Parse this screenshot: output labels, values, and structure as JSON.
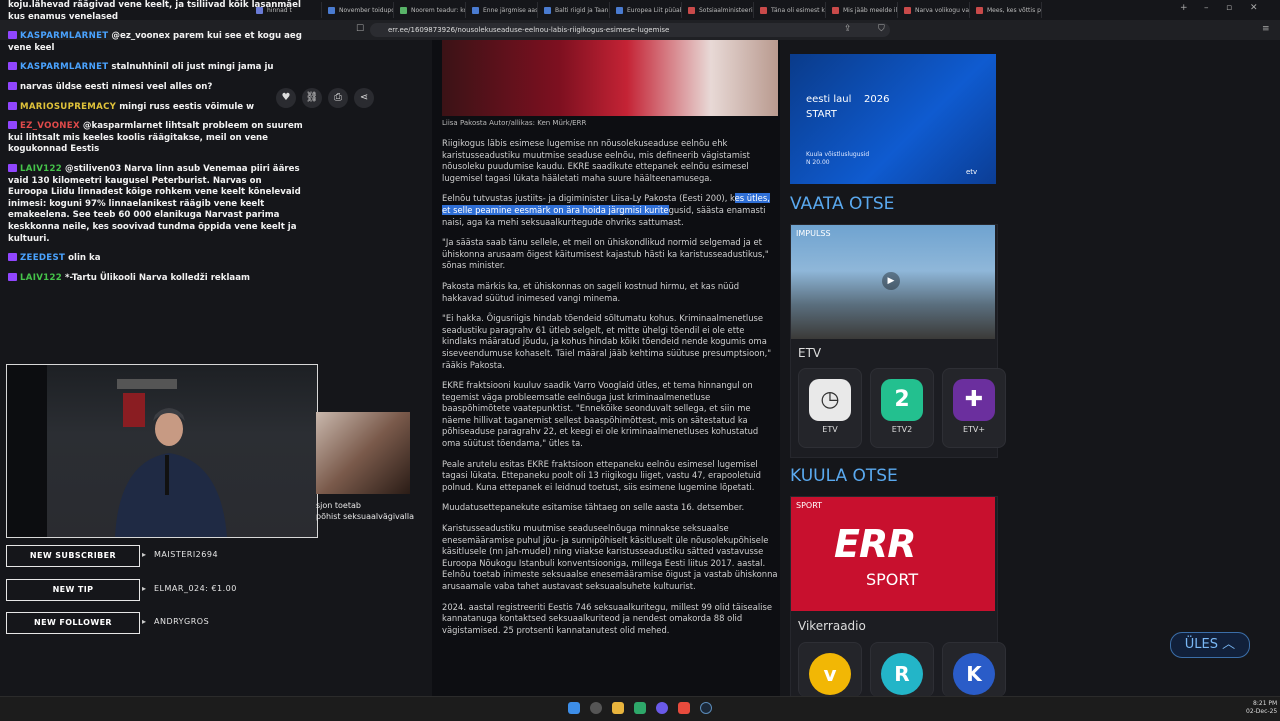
{
  "browser": {
    "tabs": [
      {
        "label": "hinnad t",
        "color": "#6a7bd6"
      },
      {
        "label": "November toidupoes",
        "color": "#4a7bd0"
      },
      {
        "label": "Noorem teadur: kooli",
        "color": "#58b368"
      },
      {
        "label": "Enne järgmise aasta",
        "color": "#4a7bd0"
      },
      {
        "label": "Balti riigid ja Taani ko",
        "color": "#4a7bd0"
      },
      {
        "label": "Europea Liit püüab",
        "color": "#4a7bd0"
      },
      {
        "label": "Sotsiaalministeerium",
        "color": "#c94a4a"
      },
      {
        "label": "Täna oli esimest kord",
        "color": "#c94a4a"
      },
      {
        "label": "Mis jääb meelde ilvy",
        "color": "#c94a4a"
      },
      {
        "label": "Narva volikogu valis",
        "color": "#c94a4a"
      },
      {
        "label": "Mees, kes võttis pära",
        "color": "#c94a4a"
      }
    ],
    "url": "err.ee/1609873926/nousolekuseaduse-eelnou-labis-riigikogus-esimese-lugemise"
  },
  "chat": [
    {
      "user": "",
      "color": "#ffffff",
      "text": "koju.lähevad räägivad vene keelt, ja tsiliivad kõik lasanmäel kus enamus venelased"
    },
    {
      "user": "KASPARMLARNET",
      "color": "#4aa3ff",
      "text": "@ez_voonex parem kui see et kogu aeg vene keel"
    },
    {
      "user": "KASPARMLARNET",
      "color": "#4aa3ff",
      "text": "stalnuhhinil oli just mingi jama ju"
    },
    {
      "user": "",
      "color": "#3a3aff",
      "text": "narvas üldse eesti nimesi veel alles on?"
    },
    {
      "user": "MARIOSUPREMACY",
      "color": "#e0c23a",
      "text": "mingi russ eestis võimule w"
    },
    {
      "user": "EZ_VOONEX",
      "color": "#e04a4a",
      "text": "@kasparmlarnet lihtsalt probleem on suurem kui lihtsalt mis keeles koolis räägitakse, meil on vene kogukonnad Eestis"
    },
    {
      "user": "LAIV122",
      "color": "#45c44a",
      "text": "@stiliven03 Narva linn asub Venemaa piiri ääres vaid 130 kilomeetri kaugusel Peterburist. Narvas on Euroopa Liidu linnadest kõige rohkem vene keelt kõnelevaid inimesi: koguni 97% linnaelanikest räägib vene keelt emakeelena. See teeb 60 000 elanikuga Narvast parima keskkonna neile, kes soovivad tundma õppida vene keelt ja kultuuri."
    },
    {
      "user": "ZEEDEST",
      "color": "#4aa3ff",
      "text": "olin ka"
    },
    {
      "user": "LAIV122",
      "color": "#45c44a",
      "text": "*-Tartu Ülikooli Narva kolledži reklaam"
    }
  ],
  "article": {
    "caption": "Liisa Pakosta Autor/allikas: Ken Mürk/ERR",
    "p1": "Riigikogus läbis esimese lugemise nn nõusolekuseaduse eelnõu ehk karistusseadustiku muutmise seaduse eelnõu, mis defineerib vägistamist nõusoleku puudumise kaudu. EKRE saadikute ettepanek eelnõu esimesel lugemisel tagasi lükata hääletati maha suure häälteenamusega.",
    "p2a": "Eelnõu tutvustas justiits- ja digiminister Liisa-Ly Pakosta (Eesti 200), k",
    "p2b": "es ütles, et selle peamine eesmärk on ära hoida järgmisi kurite",
    "p2c": "gusid, säästa enamasti naisi, aga ka mehi seksuaalkuritegude ohvriks sattumast.",
    "p3": "\"Ja säästa saab tänu sellele, et meil on ühiskondlikud normid selgemad ja et ühiskonna arusaam õigest käitumisest kajastub hästi ka karistusseadustikus,\" sõnas minister.",
    "p4": "Pakosta märkis ka, et ühiskonnas on sageli kostnud hirmu, et kas nüüd hakkavad süütud inimesed vangi minema.",
    "p5": "\"Ei hakka. Õigusriigis hindab tõendeid sõltumatu kohus. Kriminaalmenetluse seadustiku paragrahv 61 ütleb selgelt, et mitte ühelgi tõendil ei ole ette kindlaks määratud jõudu, ja kohus hindab kõiki tõendeid nende kogumis oma siseveendumuse kohaselt. Täiel määral jääb kehtima süütuse presumptsioon,\" rääkis Pakosta.",
    "p6": "EKRE fraktsiooni kuuluv saadik Varro Vooglaid ütles, et tema hinnangul on tegemist väga probleemsatle eelnõuga just kriminaalmenetluse baaspõhimõtete vaatepunktist. \"Ennekõike seonduvalt sellega, et siin me näeme hillivat taganemist sellest baaspõhimõttest, mis on sätestatud ka põhiseaduse paragrahv 22, et keegi ei ole kriminaalmenetluses kohustatud oma süütust tõendama,\" ütles ta.",
    "p7": "Peale arutelu esitas EKRE fraktsioon ettepaneku eelnõu esimesel lugemisel tagasi lükata. Ettepaneku poolt oli 13 riigikogu liiget, vastu 47, erapooletuid polnud. Kuna ettepanek ei leidnud toetust, siis esimene lugemine lõpetati.",
    "p8": "Muudatusettepanekute esitamise tähtaeg on selle aasta 16. detsember.",
    "p9": "Karistusseadustiku muutmise seaduseelnõuga minnakse seksuaalse enesemääramise puhul jõu- ja sunnipõhiselt käsitluselt üle nõusolekupõhisele käsitlusele (nn jah-mudel) ning viiakse karistusseadustiku sätted vastavusse Euroopa Nõukogu Istanbuli konventsiooniga, millega Eesti liitus 2017. aastal. Eelnõu toetab inimeste seksuaalse enesemääramise õigust ja vastab ühiskonna arusaamale vaba tahet austavast seksuaalsuhete kultuurist.",
    "p10": "2024. aastal registreeriti Eestis 746 seksuaalkuritegu, millest 99 olid täisealise kannatanuga kontaktsed seksuaalkuriteod ja nendest omakorda 88 olid vägistamised. 25 protsenti kannatanutest olid mehed."
  },
  "sidebar": {
    "evl": {
      "title": "eesti laul",
      "year": "2026",
      "start": "START",
      "sub1": "Kuula võistluslugusid",
      "sub2": "N 20.00",
      "brand": "etv"
    },
    "vaata": "VAATA OTSE",
    "impulss": "IMPULSS",
    "etv": "ETV",
    "channels": [
      {
        "name": "ETV",
        "color": "#e9e9e9",
        "glyph": "◷"
      },
      {
        "name": "ETV2",
        "color": "#23c08f",
        "glyph": "2"
      },
      {
        "name": "ETV+",
        "color": "#6b2f9e",
        "glyph": "✚"
      }
    ],
    "kuula": "KUULA OTSE",
    "sport_lbl": "SPORT",
    "err_logo": "ERR",
    "sport_txt": "SPORT",
    "vikerraadio": "Vikerraadio",
    "radios": [
      {
        "name": "",
        "color": "#f2b705",
        "glyph": "v"
      },
      {
        "name": "",
        "color": "#23b5c8",
        "glyph": "R"
      },
      {
        "name": "",
        "color": "#2a5cc8",
        "glyph": "K"
      }
    ]
  },
  "thumb_caption": {
    "l1": "sjon toetab",
    "l2": "põhist seksuaalvägivalla"
  },
  "alerts": [
    {
      "label": "NEW SUBSCRIBER",
      "value": "MAISTERI2694"
    },
    {
      "label": "NEW TIP",
      "value": "ELMAR_024: €1.00"
    },
    {
      "label": "NEW FOLLOWER",
      "value": "ANDRYGROS"
    }
  ],
  "ules": "ÜLES",
  "clock": {
    "time": "8:21 PM",
    "date": "02-Dec-25"
  }
}
